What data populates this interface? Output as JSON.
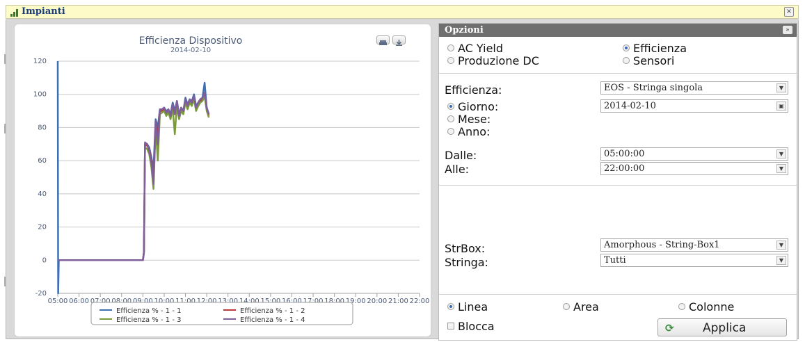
{
  "window": {
    "title": "Impianti",
    "close_glyph": "×"
  },
  "chart_data": {
    "type": "line",
    "title": "Efficienza Dispositivo",
    "subtitle": "2014-02-10",
    "ylim": [
      -20,
      120
    ],
    "yticks": [
      -20,
      0,
      20,
      40,
      60,
      80,
      100,
      120
    ],
    "xlim": [
      5,
      22
    ],
    "xtick_labels": [
      "05:00",
      "06:00",
      "07:00",
      "08:00",
      "09:00",
      "10:00",
      "11:00",
      "12:00",
      "13:00",
      "14:00",
      "15:00",
      "16:00",
      "17:00",
      "18:00",
      "19:00",
      "20:00",
      "21:00",
      "22:00"
    ],
    "grid": true,
    "legend_position": "bottom-center",
    "series": [
      {
        "name": "Efficienza % - 1 - 1",
        "color": "#3d6fb3",
        "x": [
          5.0,
          5.02,
          5.05,
          9.0,
          9.05,
          9.1,
          9.2,
          9.3,
          9.4,
          9.5,
          9.6,
          9.7,
          9.8,
          9.9,
          10.0,
          10.1,
          10.2,
          10.3,
          10.4,
          10.5,
          10.6,
          10.7,
          10.8,
          10.9,
          11.0,
          11.1,
          11.2,
          11.3,
          11.4,
          11.5,
          11.6,
          11.7,
          11.8,
          11.9,
          12.0,
          12.1
        ],
        "y": [
          120,
          -20,
          0,
          0,
          5,
          70,
          70,
          68,
          62,
          55,
          85,
          80,
          91,
          91,
          92,
          90,
          91,
          88,
          95,
          90,
          96,
          88,
          92,
          90,
          98,
          94,
          97,
          96,
          100,
          93,
          95,
          97,
          98,
          107,
          92,
          88
        ]
      },
      {
        "name": "Efficienza % - 1 - 2",
        "color": "#b83a3a",
        "x": [
          5.0,
          9.0,
          9.05,
          9.1,
          9.2,
          9.3,
          9.4,
          9.5,
          9.6,
          9.7,
          9.8,
          9.9,
          10.0,
          10.1,
          10.2,
          10.3,
          10.4,
          10.5,
          10.6,
          10.7,
          10.8,
          10.9,
          11.0,
          11.1,
          11.2,
          11.3,
          11.4,
          11.5,
          11.6,
          11.7,
          11.8,
          11.9,
          12.0,
          12.1
        ],
        "y": [
          0,
          0,
          5,
          70,
          69,
          67,
          60,
          48,
          82,
          76,
          90,
          90,
          91,
          88,
          90,
          86,
          93,
          88,
          95,
          86,
          91,
          89,
          96,
          92,
          96,
          94,
          98,
          91,
          94,
          96,
          97,
          100,
          91,
          87
        ]
      },
      {
        "name": "Efficienza % - 1 - 3",
        "color": "#7a9b3a",
        "x": [
          5.0,
          9.0,
          9.05,
          9.1,
          9.2,
          9.3,
          9.4,
          9.5,
          9.6,
          9.7,
          9.8,
          9.9,
          10.0,
          10.1,
          10.2,
          10.3,
          10.4,
          10.5,
          10.6,
          10.7,
          10.8,
          10.9,
          11.0,
          11.1,
          11.2,
          11.3,
          11.4,
          11.5,
          11.6,
          11.7,
          11.8,
          11.9,
          12.0,
          12.1
        ],
        "y": [
          0,
          0,
          4,
          68,
          67,
          64,
          56,
          43,
          80,
          60,
          88,
          89,
          90,
          87,
          89,
          85,
          92,
          76,
          93,
          85,
          90,
          88,
          95,
          91,
          95,
          93,
          97,
          90,
          93,
          95,
          96,
          99,
          90,
          86
        ]
      },
      {
        "name": "Efficienza % - 1 - 4",
        "color": "#7f5e9b",
        "x": [
          5.0,
          9.0,
          9.05,
          9.1,
          9.2,
          9.3,
          9.4,
          9.5,
          9.6,
          9.7,
          9.8,
          9.9,
          10.0,
          10.1,
          10.2,
          10.3,
          10.4,
          10.5,
          10.6,
          10.7,
          10.8,
          10.9,
          11.0,
          11.1,
          11.2,
          11.3,
          11.4,
          11.5,
          11.6,
          11.7,
          11.8,
          11.9,
          12.0,
          12.1
        ],
        "y": [
          0,
          0,
          5,
          71,
          70,
          66,
          59,
          46,
          84,
          70,
          91,
          91,
          92,
          89,
          91,
          87,
          94,
          88,
          96,
          87,
          92,
          90,
          97,
          93,
          97,
          95,
          99,
          92,
          95,
          97,
          98,
          101,
          92,
          88
        ]
      }
    ]
  },
  "options": {
    "header": "Opzioni",
    "collapse_glyph": "»",
    "measures": [
      {
        "label": "AC Yield",
        "selected": false
      },
      {
        "label": "Efficienza",
        "selected": true
      },
      {
        "label": "Produzione DC",
        "selected": false
      },
      {
        "label": "Sensori",
        "selected": false
      }
    ],
    "efficienza_label": "Efficienza:",
    "efficienza_value": "EOS - Stringa singola",
    "periods": [
      {
        "label": "Giorno:",
        "selected": true
      },
      {
        "label": "Mese:",
        "selected": false
      },
      {
        "label": "Anno:",
        "selected": false
      }
    ],
    "date_value": "2014-02-10",
    "dalle_label": "Dalle:",
    "dalle_value": "05:00:00",
    "alle_label": "Alle:",
    "alle_value": "22:00:00",
    "strbox_label": "StrBox:",
    "strbox_value": "Amorphous - String-Box1",
    "stringa_label": "Stringa:",
    "stringa_value": "Tutti",
    "chart_types": [
      {
        "label": "Linea",
        "selected": true
      },
      {
        "label": "Area",
        "selected": false
      },
      {
        "label": "Colonne",
        "selected": false
      }
    ],
    "blocca_label": "Blocca",
    "apply_label": "Applica"
  }
}
